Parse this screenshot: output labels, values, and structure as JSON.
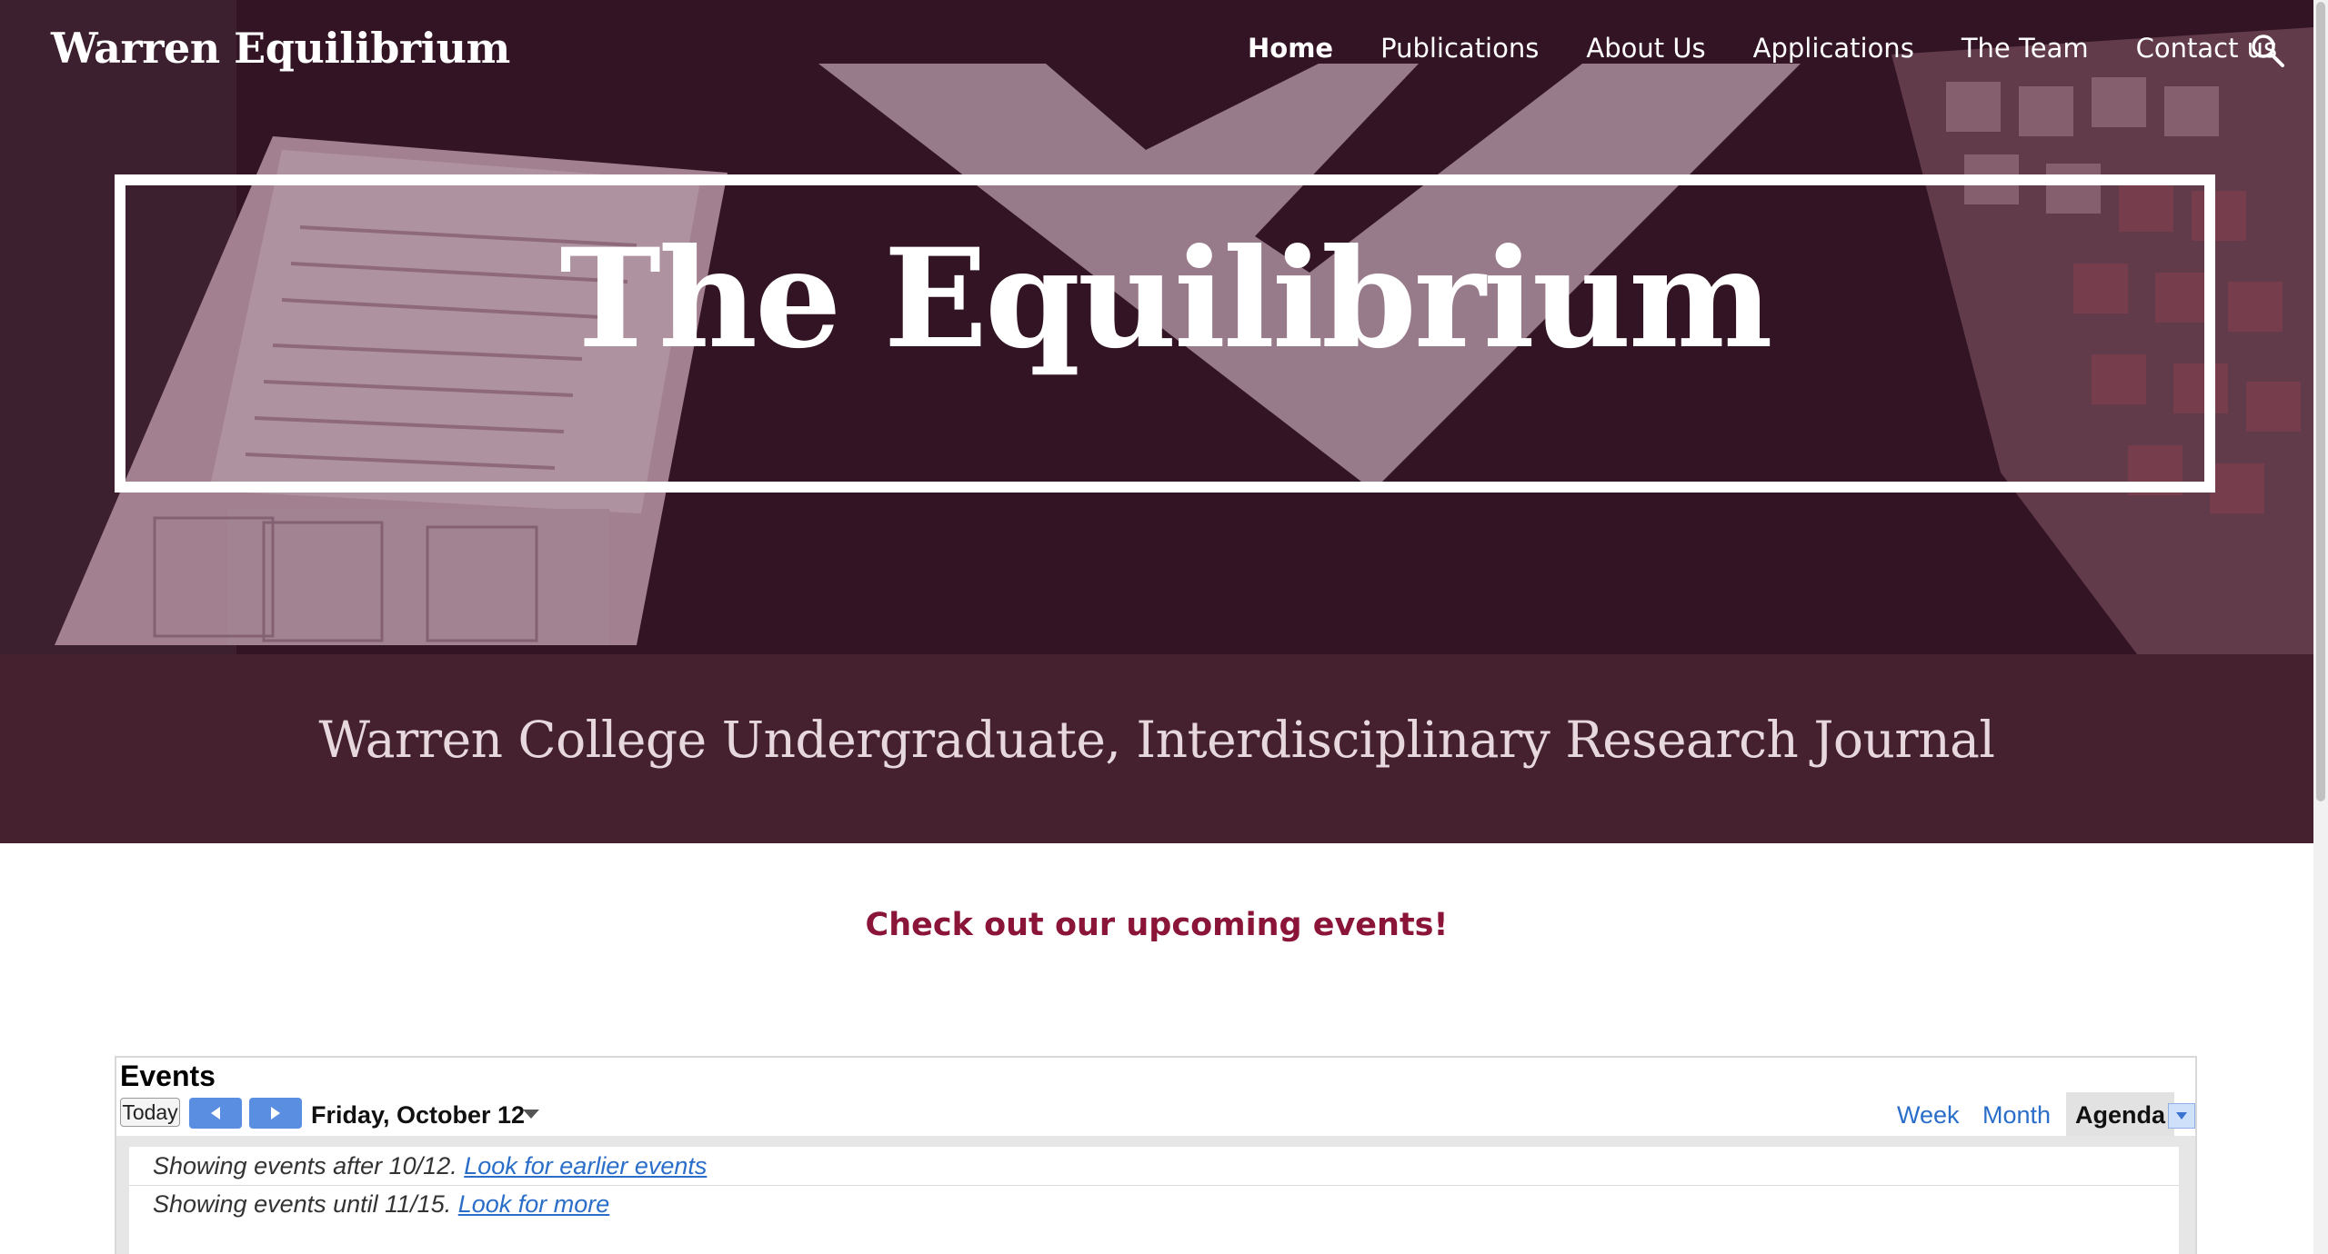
{
  "header": {
    "site_title": "Warren Equilibrium",
    "nav": [
      {
        "label": "Home",
        "active": true
      },
      {
        "label": "Publications"
      },
      {
        "label": "About Us"
      },
      {
        "label": "Applications"
      },
      {
        "label": "The Team"
      },
      {
        "label": "Contact us"
      }
    ],
    "search_icon": "search-icon"
  },
  "hero": {
    "title": "The Equilibrium"
  },
  "subtitle_band": {
    "text": "Warren College Undergraduate, Interdisciplinary Research Journal"
  },
  "events_section": {
    "heading": "Check out our upcoming events!",
    "calendar": {
      "title": "Events",
      "today_label": "Today",
      "prev_icon": "triangle-left-icon",
      "next_icon": "triangle-right-icon",
      "date_label": "Friday, October 12",
      "views": [
        "Week",
        "Month",
        "Agenda"
      ],
      "active_view": "Agenda",
      "agenda": {
        "row1_text": "Showing events after 10/12.",
        "row1_link": "Look for earlier events",
        "row2_text": "Showing events until 11/15.",
        "row2_link": "Look for more"
      }
    }
  },
  "colors": {
    "accent": "#8b1538",
    "band": "#45202f",
    "link": "#2a6ec9"
  }
}
